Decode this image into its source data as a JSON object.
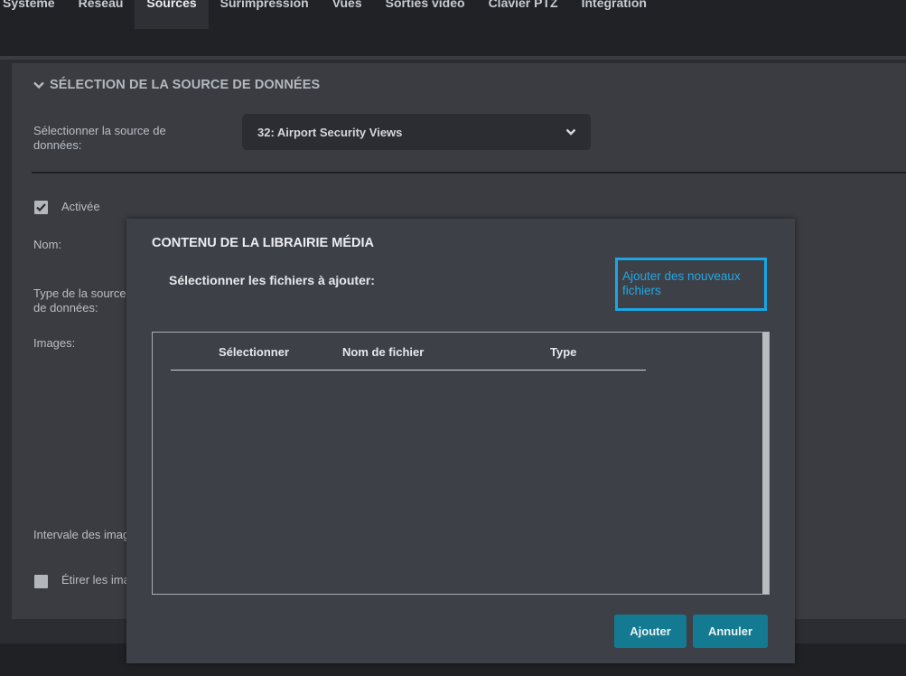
{
  "nav": {
    "tabs": [
      {
        "label": "Système"
      },
      {
        "label": "Réseau"
      },
      {
        "label": "Sources"
      },
      {
        "label": "Surimpression"
      },
      {
        "label": "Vues"
      },
      {
        "label": "Sorties vidéo"
      },
      {
        "label": "Clavier PTZ"
      },
      {
        "label": "Intégration"
      }
    ],
    "active": "Sources"
  },
  "section": {
    "title": "SÉLECTION DE LA SOURCE DE DONNÉES",
    "select_label": "Sélectionner la source de données:",
    "select_value": "32: Airport Security Views"
  },
  "form": {
    "enabled_label": "Activée",
    "enabled_checked": true,
    "name_label": "Nom:",
    "type_label": "Type de la source de données:",
    "images_label": "Images:",
    "interval_label": "Intervale des images",
    "stretch_label": "Étirer les images",
    "stretch_checked": false
  },
  "modal": {
    "title": "CONTENU DE LA LIBRAIRIE MÉDIA",
    "subtitle": "Sélectionner les fichiers à ajouter:",
    "add_files_link": "Ajouter des nouveaux fichiers",
    "columns": [
      "Sélectionner",
      "Nom de fichier",
      "Type"
    ],
    "rows": [],
    "add_button": "Ajouter",
    "cancel_button": "Annuler"
  },
  "colors": {
    "accent": "#19a6e6",
    "button": "#147a91"
  }
}
